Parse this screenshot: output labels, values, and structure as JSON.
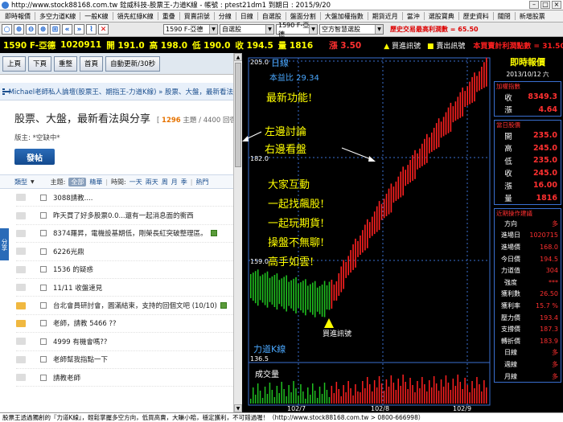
{
  "window": {
    "title": "http://www.stock88168.com.tw 銓威科技-股票王-力道K線 - 帳號 : ptest21dm1 到期日 : 2015/9/20"
  },
  "menu": {
    "items": [
      "即時報價",
      "多空力道K線",
      "一般K線",
      "領先紅綠K線",
      "重疊",
      "買賣訊號",
      "分線",
      "日線",
      "自選股",
      "盤面分割",
      "大盤加權指數",
      "期貨近月",
      "當沖",
      "選股寶典",
      "歷史資料",
      "關閉",
      "新增股票"
    ]
  },
  "toolbar": {
    "select1": "1590 F-亞德",
    "select2": "自選股",
    "select3": "1590 F-亞德",
    "select4": "空方智慧選股",
    "promo_label": "歷史交易最高利潤數 = ",
    "promo_value": "65.50"
  },
  "quote": {
    "symbol": "1590 F-亞德",
    "code": "1020911",
    "open_label": "開",
    "open": "191.0",
    "high_label": "高",
    "high": "198.0",
    "low_label": "低",
    "low": "190.0",
    "close_label": "收",
    "close": "194.5",
    "vol_label": "量",
    "vol": "1816",
    "change": "漲 3.50",
    "buy_signal": "買進訊號",
    "sell_signal": "賣出訊號",
    "profit_label": "本買賣計利潤點數 = ",
    "profit_value": "31.50"
  },
  "web": {
    "nav_buttons": [
      "上頁",
      "下頁",
      "重整",
      "首頁",
      "自動更新/30秒"
    ],
    "breadcrumb": "Michael老師私人論壇(股票王、期指王-力道K線) » 股票、大盤，最新看法",
    "forum_title": "股票、大盤，最新看法與分享",
    "topic_count": "1296",
    "topic_label": " 主題 / 4400 回復 ]",
    "topic_open": "[ ",
    "moderator": "版主: *空缺中*",
    "post_button": "發帖",
    "side_tab": "分享",
    "filter": {
      "category": "類型",
      "subject": "主題:",
      "all": "全部",
      "best": "精華",
      "time": "時間:",
      "day": "一天",
      "two": "兩天",
      "week": "周",
      "month": "月",
      "season": "季",
      "hot": "熱門"
    },
    "threads": [
      {
        "title": "3088請教....",
        "hot": false,
        "img": false
      },
      {
        "title": "昨天買了好多股票0.0...還有一起消息面的衝西",
        "hot": false,
        "img": false
      },
      {
        "title": "8374羅昇，電機設基期低，剛榮長紅突破整理區。",
        "hot": false,
        "img": true
      },
      {
        "title": "6226光鼎",
        "hot": false,
        "img": false
      },
      {
        "title": "1536 的疑惑",
        "hot": false,
        "img": false
      },
      {
        "title": "11/11 收盤速見",
        "hot": false,
        "img": false
      },
      {
        "title": "台北會員研討會，圓滿結束，支持的回個文吧 (10/10)",
        "hot": true,
        "img": true
      },
      {
        "title": "老師，請教 5466 ??",
        "hot": true,
        "img": false
      },
      {
        "title": "4999 有機會嗎??",
        "hot": false,
        "img": false
      },
      {
        "title": "老師幫我指點一下",
        "hot": false,
        "img": false
      },
      {
        "title": "請教老師",
        "hot": false,
        "img": false
      }
    ]
  },
  "chart": {
    "period_label": "日線",
    "ratio_label": "本益比 29.34",
    "price_ticks": [
      "205.0",
      "182.0",
      "159.0",
      "136.5"
    ],
    "volume_label": "成交量",
    "xaxis_labels": [
      "102/7",
      "102/8",
      "102/9"
    ],
    "annotation_new": "最新功能!",
    "annotation_left": "左邊討論",
    "annotation_right": "右邊看盤",
    "annotation_lines": [
      "大家互動",
      "一起找飆股!",
      "一起玩期貨!",
      "操盤不無聊!",
      "高手如雲!"
    ],
    "buy_signal_label": "買進訊號",
    "force_k_label": "力道K線"
  },
  "right": {
    "title": "即時報價",
    "date": "2013/10/12 六",
    "index_label": "加權指數",
    "index_rows": [
      {
        "k": "收",
        "v": "8349.3"
      },
      {
        "k": "漲",
        "v": "4.64"
      }
    ],
    "day_label": "當日股價",
    "day_rows": [
      {
        "k": "開",
        "v": "235.0"
      },
      {
        "k": "高",
        "v": "245.0"
      },
      {
        "k": "低",
        "v": "235.0"
      },
      {
        "k": "收",
        "v": "245.0"
      },
      {
        "k": "漲",
        "v": "16.00"
      },
      {
        "k": "量",
        "v": "1816"
      }
    ],
    "ops_label": "近期操作建議",
    "ops_rows": [
      {
        "k": "方向",
        "v": "多"
      },
      {
        "k": "進場日",
        "v": "1020715"
      },
      {
        "k": "進場價",
        "v": "168.0"
      },
      {
        "k": "今日價",
        "v": "194.5"
      },
      {
        "k": "力道值",
        "v": "304"
      },
      {
        "k": "強度",
        "v": "***"
      },
      {
        "k": "獲利數",
        "v": "26.50"
      },
      {
        "k": "獲利率",
        "v": "15.7 %"
      },
      {
        "k": "壓力價",
        "v": "193.4"
      },
      {
        "k": "支撐價",
        "v": "187.3"
      },
      {
        "k": "轉折價",
        "v": "183.9"
      },
      {
        "k": "日線",
        "v": "多"
      },
      {
        "k": "週線",
        "v": "多"
      },
      {
        "k": "月線",
        "v": "多"
      }
    ]
  },
  "status": {
    "text": "股票王透過獨創的『力道K線』，輕鬆掌握多空方向，低買高賣，大賺小賠，穩定獲利，不可錯過喔！（http://www.stock88168.com.tw > 0800-666998）"
  },
  "colors": {
    "up": "#ff2020",
    "down": "#20c020",
    "accent": "#ffff00",
    "frame": "#3a6fd0"
  }
}
